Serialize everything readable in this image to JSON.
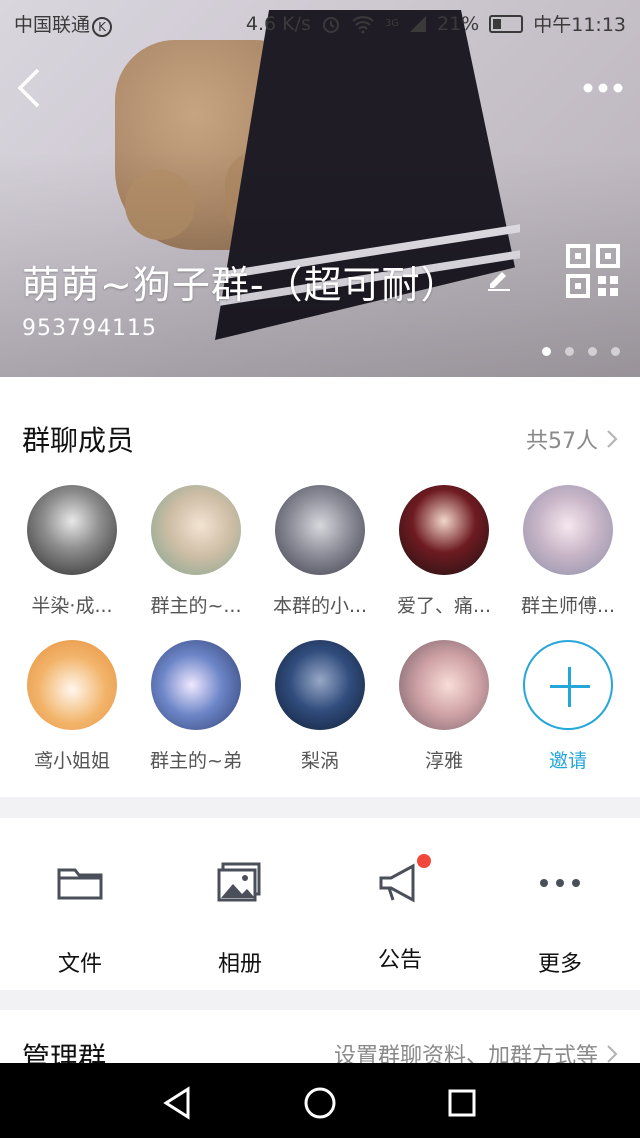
{
  "status_bar": {
    "carrier": "中国联通",
    "carrier_badge": "K",
    "speed": "4.6 K/s",
    "signal_badge": "3G",
    "battery": "21%",
    "time": "中午11:13"
  },
  "header": {
    "group_name": "萌萌~狗子群-（超可耐）",
    "group_id": "953794115",
    "page_dots": 4,
    "active_dot": 0
  },
  "members": {
    "title": "群聊成员",
    "count_label": "共57人",
    "items": [
      {
        "name": "半染·成..."
      },
      {
        "name": "群主的~..."
      },
      {
        "name": "本群的小..."
      },
      {
        "name": "爱了、痛..."
      },
      {
        "name": "群主师傅..."
      },
      {
        "name": "鸢小姐姐"
      },
      {
        "name": "群主的~弟"
      },
      {
        "name": "梨涡"
      },
      {
        "name": "淳雅"
      }
    ],
    "invite_label": "邀请"
  },
  "actions": [
    {
      "label": "文件",
      "icon": "folder-icon"
    },
    {
      "label": "相册",
      "icon": "album-icon"
    },
    {
      "label": "公告",
      "icon": "announcement-icon"
    },
    {
      "label": "更多",
      "icon": "more-icon"
    }
  ],
  "manage": {
    "title": "管理群",
    "desc": "设置群聊资料、加群方式等"
  },
  "colors": {
    "accent": "#25a6d9",
    "badge_red": "#f2473b",
    "text_primary": "#111111",
    "text_secondary": "#8a8a8a"
  }
}
